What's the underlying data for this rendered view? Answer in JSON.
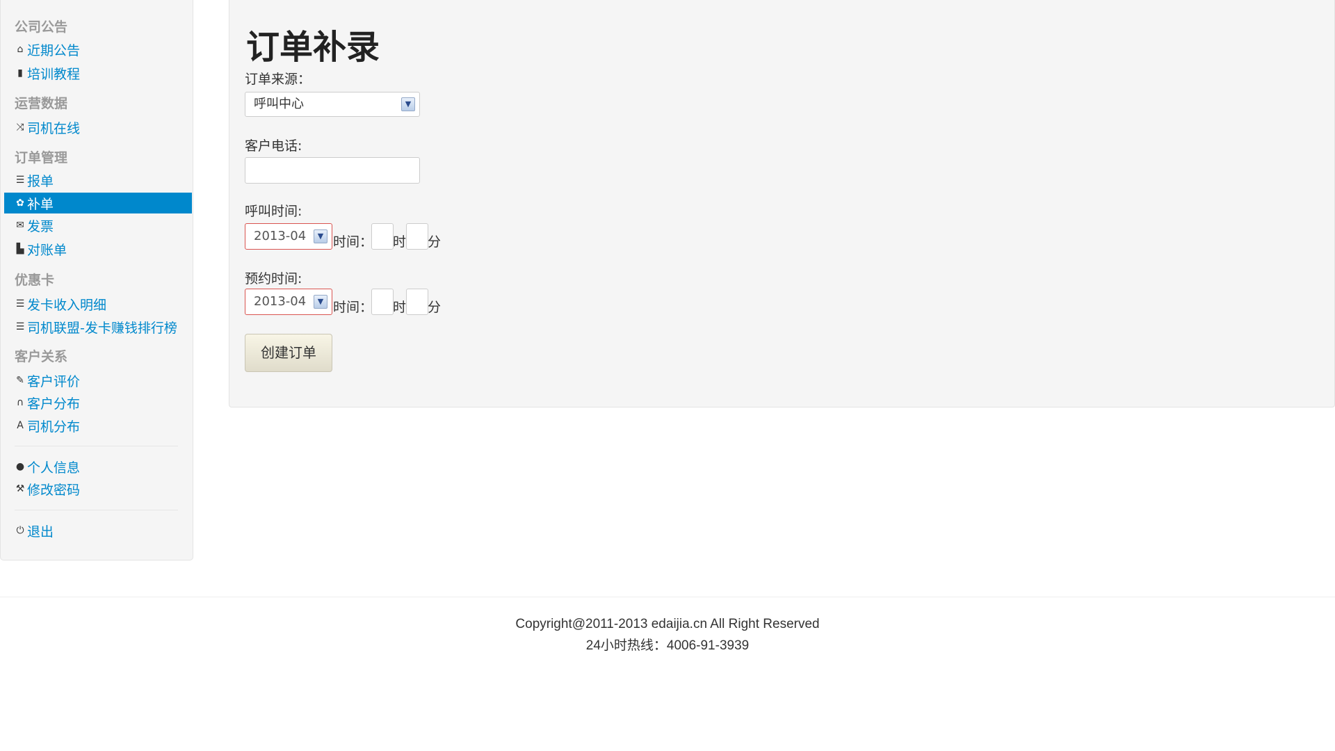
{
  "sidebar": {
    "sections": [
      {
        "header": "公司公告",
        "items": [
          {
            "label": "近期公告",
            "icon": "home-icon"
          },
          {
            "label": "培训教程",
            "icon": "book-icon"
          }
        ]
      },
      {
        "header": "运营数据",
        "items": [
          {
            "label": "司机在线",
            "icon": "random-icon"
          }
        ]
      },
      {
        "header": "订单管理",
        "items": [
          {
            "label": "报单",
            "icon": "list-icon"
          },
          {
            "label": "补单",
            "icon": "gear-icon",
            "active": true
          },
          {
            "label": "发票",
            "icon": "envelope-icon"
          },
          {
            "label": "对账单",
            "icon": "file-icon"
          }
        ]
      },
      {
        "header": "优惠卡",
        "items": [
          {
            "label": "发卡收入明细",
            "icon": "list-icon"
          },
          {
            "label": "司机联盟-发卡赚钱排行榜",
            "icon": "list-icon"
          }
        ]
      },
      {
        "header": "客户关系",
        "items": [
          {
            "label": "客户评价",
            "icon": "pencil-icon"
          },
          {
            "label": "客户分布",
            "icon": "headphones-icon"
          },
          {
            "label": "司机分布",
            "icon": "font-icon"
          }
        ]
      }
    ],
    "account": [
      {
        "label": "个人信息",
        "icon": "user-icon"
      },
      {
        "label": "修改密码",
        "icon": "wrench-icon"
      }
    ],
    "logout": {
      "label": "退出",
      "icon": "power-icon"
    }
  },
  "main": {
    "title": "订单补录",
    "order_source_label": "订单来源：",
    "order_source_value": "呼叫中心",
    "phone_label": "客户电话:",
    "phone_value": "",
    "call_time_label": "呼叫时间:",
    "call_date_value": "2013-04",
    "reserve_time_label": "预约时间:",
    "reserve_date_value": "2013-04",
    "time_label": "时间：",
    "hour_label": "时",
    "minute_label": "分",
    "create_button": "创建订单"
  },
  "footer": {
    "copyright": "Copyright@2011-2013 edaijia.cn All Right Reserved",
    "hotline": "24小时热线：4006-91-3939"
  },
  "colors": {
    "accent": "#0088cc",
    "well_bg": "#f5f5f5",
    "error_border": "#d9534f"
  }
}
